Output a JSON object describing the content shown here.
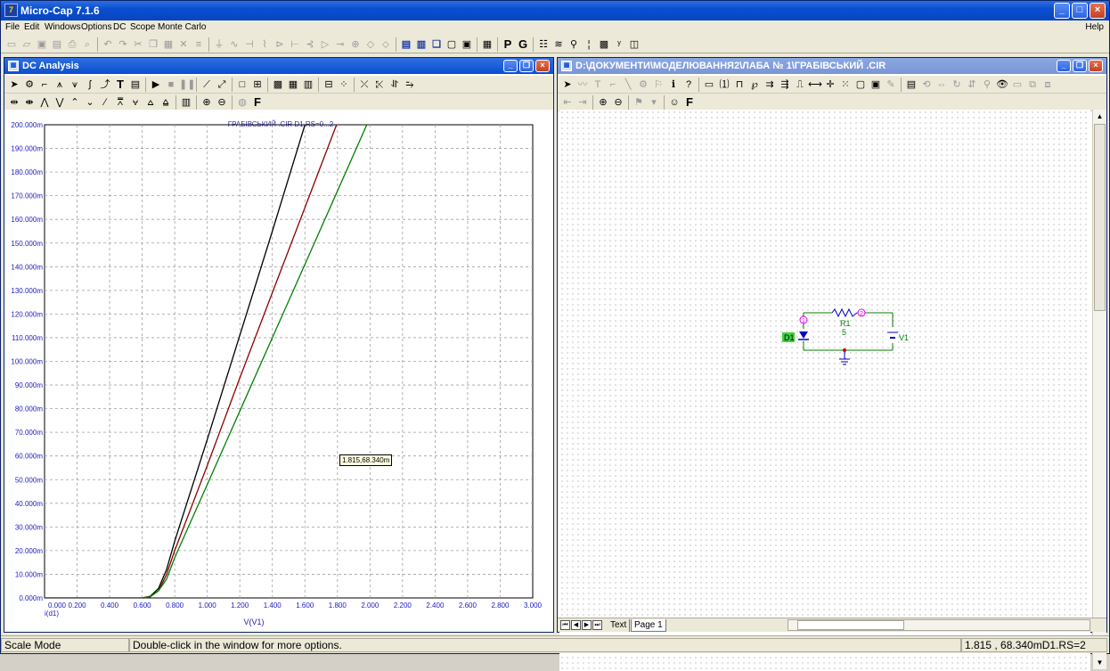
{
  "app": {
    "title": "Micro-Cap 7.1.6",
    "icon": "microcap-logo"
  },
  "menu": [
    "File",
    "Edit",
    "Windows",
    "Options",
    "DC",
    "Scope",
    "Monte Carlo"
  ],
  "menu_help": "Help",
  "toolbar_text": {
    "p_label": "P",
    "g_label": "G"
  },
  "dc_window": {
    "title": "DC Analysis",
    "chart_title": "ГРАБІВСЬКИЙ .CIR D1.RS=0...2",
    "x_axis_label": "V(V1)",
    "y_axis_label": "i(d1)",
    "cursor_readout": "1.815,68.340m"
  },
  "chart_data": {
    "type": "line",
    "title": "ГРАБІВСЬКИЙ .CIR D1.RS=0...2",
    "xlabel": "V(V1)",
    "ylabel": "i(d1)",
    "xlim": [
      0,
      3
    ],
    "ylim": [
      0,
      0.2
    ],
    "grid": true,
    "x_ticks": [
      "0.000",
      "0.200",
      "0.400",
      "0.600",
      "0.800",
      "1.000",
      "1.200",
      "1.400",
      "1.600",
      "1.800",
      "2.000",
      "2.200",
      "2.400",
      "2.600",
      "2.800",
      "3.000"
    ],
    "y_ticks": [
      "0.000m",
      "10.000m",
      "20.000m",
      "30.000m",
      "40.000m",
      "50.000m",
      "60.000m",
      "70.000m",
      "80.000m",
      "90.000m",
      "100.000m",
      "110.000m",
      "120.000m",
      "130.000m",
      "140.000m",
      "150.000m",
      "160.000m",
      "170.000m",
      "180.000m",
      "190.000m",
      "200.000m"
    ],
    "series": [
      {
        "color": "#000000",
        "x": [
          0,
          0.6,
          0.65,
          0.7,
          0.75,
          0.8,
          1.0,
          1.2,
          1.4,
          1.6,
          1.8
        ],
        "y": [
          0,
          0,
          0.0007,
          0.004,
          0.012,
          0.024,
          0.067,
          0.111,
          0.155,
          0.2,
          0.245
        ]
      },
      {
        "color": "#8b0000",
        "x": [
          0,
          0.6,
          0.65,
          0.7,
          0.75,
          0.8,
          1.0,
          1.2,
          1.4,
          1.6,
          1.8,
          2.0
        ],
        "y": [
          0,
          0,
          0.0006,
          0.003,
          0.01,
          0.02,
          0.056,
          0.093,
          0.129,
          0.165,
          0.201,
          0.237
        ]
      },
      {
        "color": "#008000",
        "x": [
          0,
          0.6,
          0.65,
          0.7,
          0.75,
          0.8,
          1.0,
          1.2,
          1.4,
          1.6,
          1.8,
          2.0,
          2.2
        ],
        "y": [
          0,
          0,
          0.0005,
          0.003,
          0.008,
          0.017,
          0.048,
          0.079,
          0.11,
          0.141,
          0.172,
          0.203,
          0.234
        ]
      }
    ]
  },
  "schematic_window": {
    "title": "D:\\ДОКУМЕНТИ\\МОДЕЛЮВАННЯ2\\ЛАБА № 1\\ГРАБІВСЬКИЙ .CIR",
    "tabs": [
      "Text",
      "Page 1"
    ],
    "components": {
      "diode": "D1",
      "resistor": "R1",
      "resistor_value": "5",
      "source": "V1",
      "node1": "1",
      "node2": "2"
    }
  },
  "status": {
    "mode": "Scale Mode",
    "hint": "Double-click in the window for more options.",
    "readout": "1.815 , 68.340mD1.RS=2"
  }
}
